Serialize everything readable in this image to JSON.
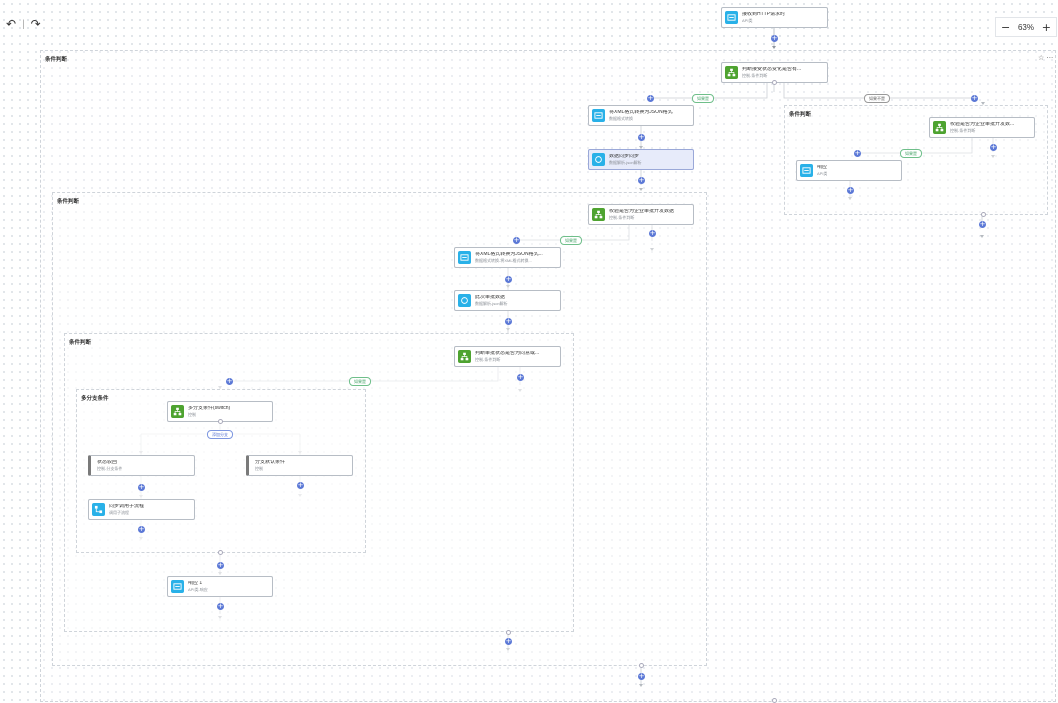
{
  "toolbar": {
    "undo_icon": "↶",
    "sep": "|",
    "redo_icon": "↷"
  },
  "zoom": {
    "minus": "−",
    "value": "63%",
    "plus": "+"
  },
  "corner": {
    "star": "☆",
    "more": "···"
  },
  "containers": {
    "c1": "条件判断",
    "c2": "条件判断",
    "c3": "条件判断",
    "c4": "条件判断",
    "c5": "多分支条件"
  },
  "nodes": {
    "n_http": {
      "title": "接收到HTTP请求时",
      "sub": "API类"
    },
    "n_judge_main": {
      "title": "判断接受状态变化是否有...",
      "sub": "控制-条件判断"
    },
    "n_xml1": {
      "title": "将XML格式转换为JSON格式",
      "sub": "数据格式转换"
    },
    "n_parse1": {
      "title": "数据同步同步",
      "sub": "数据解析-json解析"
    },
    "n_judge_r": {
      "title": "校验是否为企业审批开发数...",
      "sub": "控制-条件判断"
    },
    "n_resp_r": {
      "title": "响应",
      "sub": "API类"
    },
    "n_judge2": {
      "title": "校验是否为企业审批开发数据",
      "sub": "控制-条件判断"
    },
    "n_xml2": {
      "title": "将XML格式转换为JSON格式...",
      "sub": "数据格式转换-将XML格式转换..."
    },
    "n_parse2": {
      "title": "此次审批数据",
      "sub": "数据解析-json解析"
    },
    "n_judge3": {
      "title": "判断审批状态是否为同意或...",
      "sub": "控制-条件判断"
    },
    "n_switch": {
      "title": "多分支条件(switch)",
      "sub": "控制"
    },
    "n_branch1": {
      "title": "状态驳回",
      "sub": "控制-分支条件"
    },
    "n_branch2": {
      "title": "分支默认条件",
      "sub": "控制"
    },
    "n_sub": {
      "title": "同步调用子流程",
      "sub": "调用子流程"
    },
    "n_resp1": {
      "title": "响应 1",
      "sub": "API类-响应"
    }
  },
  "pills": {
    "p1": "如果是",
    "p2": "如果不是",
    "p3": "如果是",
    "p4": "如果是",
    "p5": "如果是",
    "p6": "添加分支"
  },
  "plus_label": "+",
  "icons": {
    "api": "api-icon",
    "control": "branch-icon"
  },
  "colors": {
    "accent": "#5b78d6",
    "api": "#29b1e8",
    "control": "#4ea330",
    "pill_green": "#3a9e5f"
  }
}
